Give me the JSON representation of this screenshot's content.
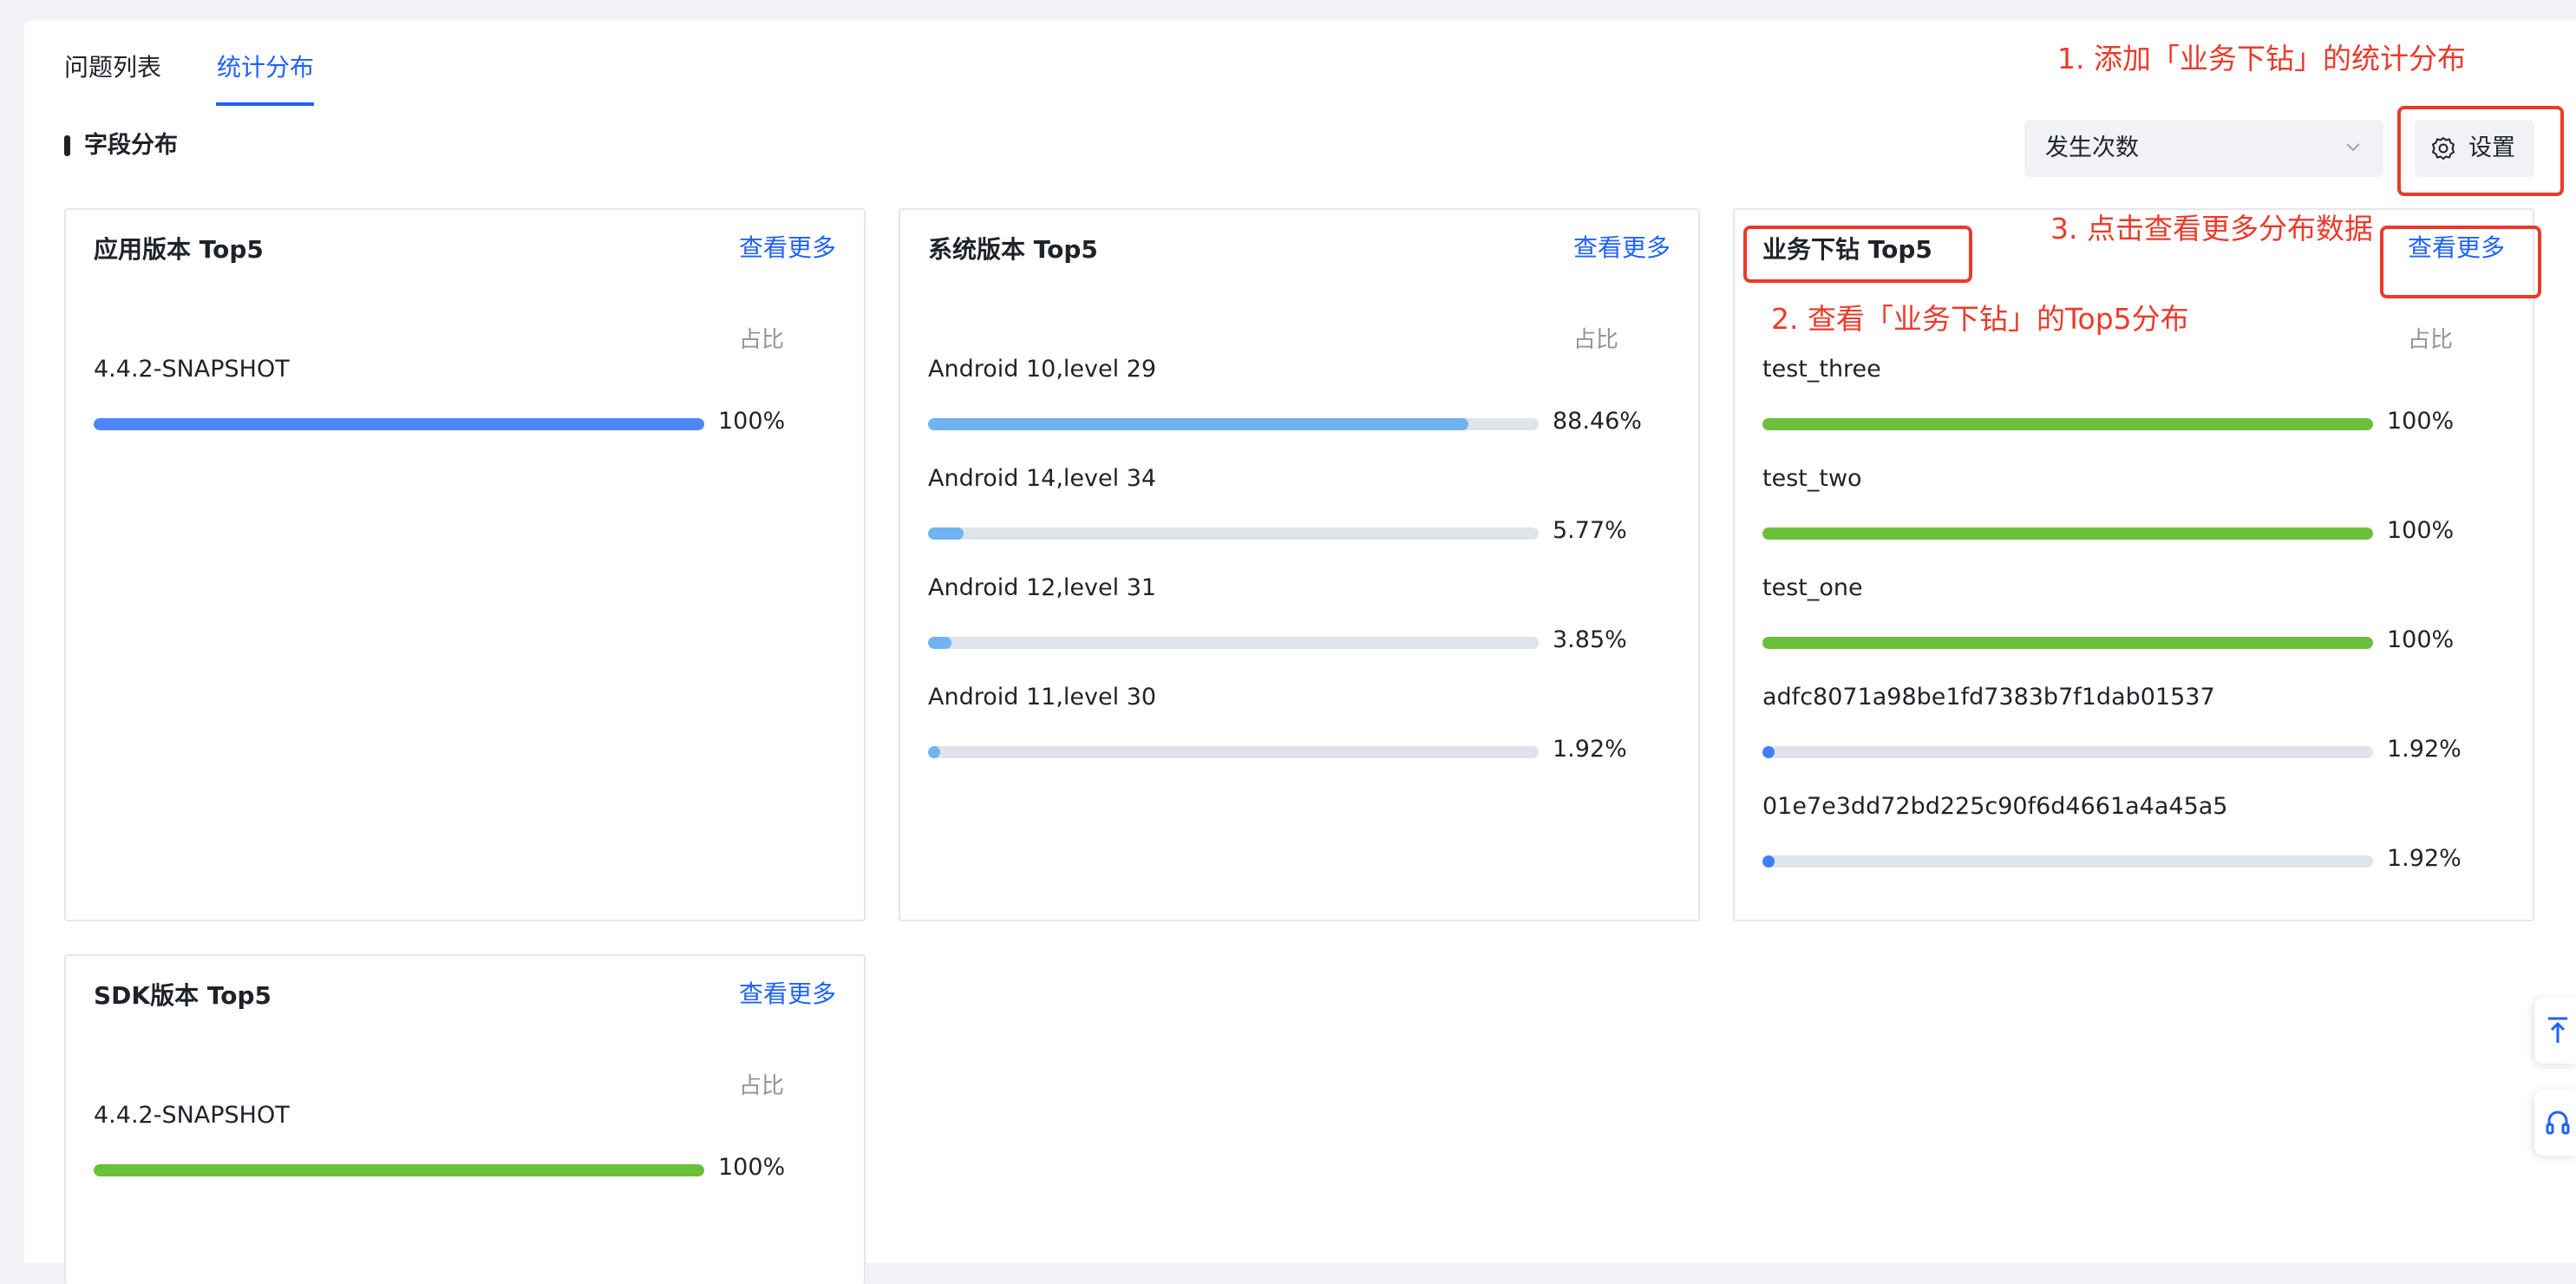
{
  "tabs": [
    {
      "label": "问题列表",
      "active": false
    },
    {
      "label": "统计分布",
      "active": true
    }
  ],
  "section": {
    "title": "字段分布"
  },
  "toolbar": {
    "metric_select_value": "发生次数",
    "settings_label": "设置"
  },
  "cards": [
    {
      "title": "应用版本 Top5",
      "more_label": "查看更多",
      "column_label": "占比",
      "rows": [
        {
          "label": "4.4.2-SNAPSHOT",
          "percent_text": "100%",
          "fraction": 1.0
        }
      ]
    },
    {
      "title": "系统版本 Top5",
      "more_label": "查看更多",
      "column_label": "占比",
      "rows": [
        {
          "label": "Android 10,level 29",
          "percent_text": "88.46%",
          "fraction": 0.8846
        },
        {
          "label": "Android 14,level 34",
          "percent_text": "5.77%",
          "fraction": 0.0577
        },
        {
          "label": "Android 12,level 31",
          "percent_text": "3.85%",
          "fraction": 0.0385
        },
        {
          "label": "Android 11,level 30",
          "percent_text": "1.92%",
          "fraction": 0.0192
        }
      ]
    },
    {
      "title": "业务下钻 Top5",
      "more_label": "查看更多",
      "column_label": "占比",
      "rows": [
        {
          "label": "test_three",
          "percent_text": "100%",
          "fraction": 1.0
        },
        {
          "label": "test_two",
          "percent_text": "100%",
          "fraction": 1.0
        },
        {
          "label": "test_one",
          "percent_text": "100%",
          "fraction": 1.0
        },
        {
          "label": "adfc8071a98be1fd7383b7f1dab01537",
          "percent_text": "1.92%",
          "fraction": 0.0192
        },
        {
          "label": "01e7e3dd72bd225c90f6d4661a4a45a5",
          "percent_text": "1.92%",
          "fraction": 0.0192
        }
      ]
    },
    {
      "title": "SDK版本 Top5",
      "more_label": "查看更多",
      "column_label": "占比",
      "rows": [
        {
          "label": "4.4.2-SNAPSHOT",
          "percent_text": "100%",
          "fraction": 1.0
        }
      ]
    }
  ],
  "annotations": {
    "step1": "1. 添加「业务下钻」的统计分布",
    "step2": "2. 查看「业务下钻」的Top5分布",
    "step3": "3. 点击查看更多分布数据"
  },
  "colors": {
    "accent": "#1f62ff",
    "bar_blue": "#4e86f7",
    "bar_light_blue": "#6fb3f2",
    "bar_green": "#6bbf3b",
    "bar_dot_blue": "#3d7ff5",
    "annotation_red": "#ec3a2a"
  },
  "icons": {
    "settings": "gear-icon",
    "select": "chevron-down-icon",
    "float_top": "back-to-top-icon",
    "float_support": "headset-icon"
  }
}
